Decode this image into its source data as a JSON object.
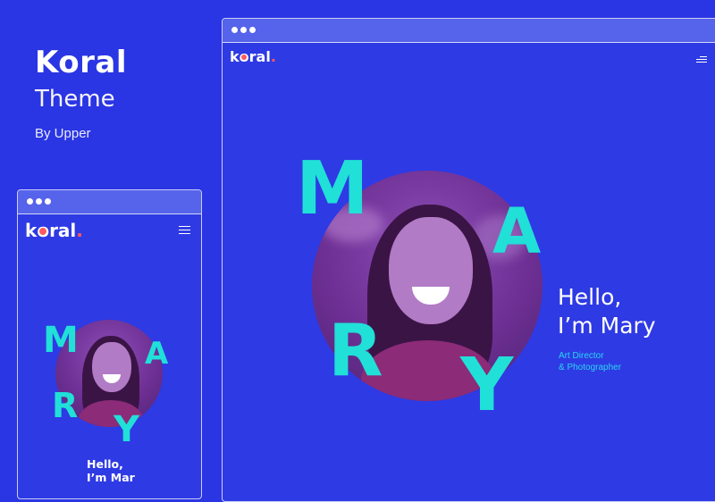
{
  "promo": {
    "title": "Koral",
    "subtitle": "Theme",
    "byline": "By Upper"
  },
  "desktop": {
    "logo": {
      "pre": "k",
      "o": "o",
      "post": "ral",
      "dot": "."
    },
    "letters": {
      "m": "M",
      "a": "A",
      "r": "R",
      "y": "Y"
    },
    "hello_line1": "Hello,",
    "hello_line2": "I’m Mary",
    "role_line1": "Art Director",
    "role_line2": "& Photographer"
  },
  "mobile": {
    "logo": {
      "pre": "k",
      "o": "o",
      "post": "ral",
      "dot": "."
    },
    "letters": {
      "m": "M",
      "a": "A",
      "r": "R",
      "y": "Y"
    },
    "hello_line1": "Hello,",
    "hello_line2": "I’m Mar"
  },
  "colors": {
    "background": "#2a35e3",
    "accent_letters": "#20e0d8",
    "logo_dot": "#ff5a5f",
    "photo_tint": "#7b3aa6",
    "role_text": "#29d6f0"
  },
  "icons": [
    "window-dot-icon",
    "hamburger-menu-icon",
    "portrait-photo"
  ]
}
